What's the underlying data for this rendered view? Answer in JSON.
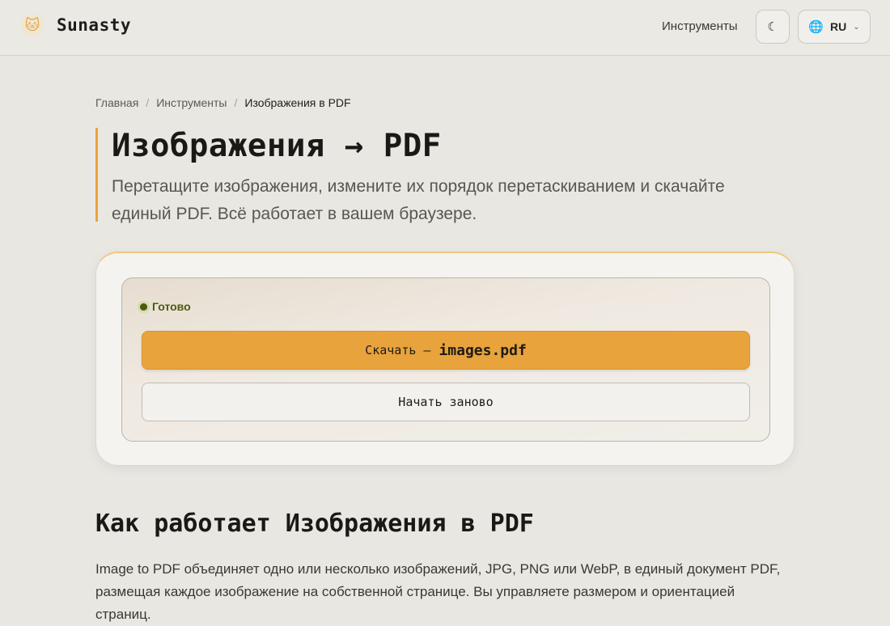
{
  "header": {
    "brand": "Sunasty",
    "nav_tools": "Инструменты",
    "theme_icon": "moon-icon",
    "lang": "RU"
  },
  "breadcrumb": {
    "home": "Главная",
    "tools": "Инструменты",
    "current": "Изображения в PDF"
  },
  "hero": {
    "title": "Изображения → PDF",
    "description": "Перетащите изображения, измените их порядок перетаскиванием и скачайте единый PDF. Всё работает в вашем браузере."
  },
  "tool": {
    "status": "Готово",
    "download_label": "Скачать —",
    "download_filename": "images.pdf",
    "restart_label": "Начать заново"
  },
  "about": {
    "title": "Как работает Изображения в PDF",
    "text": "Image to PDF объединяет одно или несколько изображений, JPG, PNG или WebP, в единый документ PDF, размещая каждое изображение на собственной странице. Вы управляете размером и ориентацией страниц."
  },
  "colors": {
    "accent": "#e8a33c",
    "background": "#e9e7e2",
    "status_green": "#4d5a10"
  }
}
